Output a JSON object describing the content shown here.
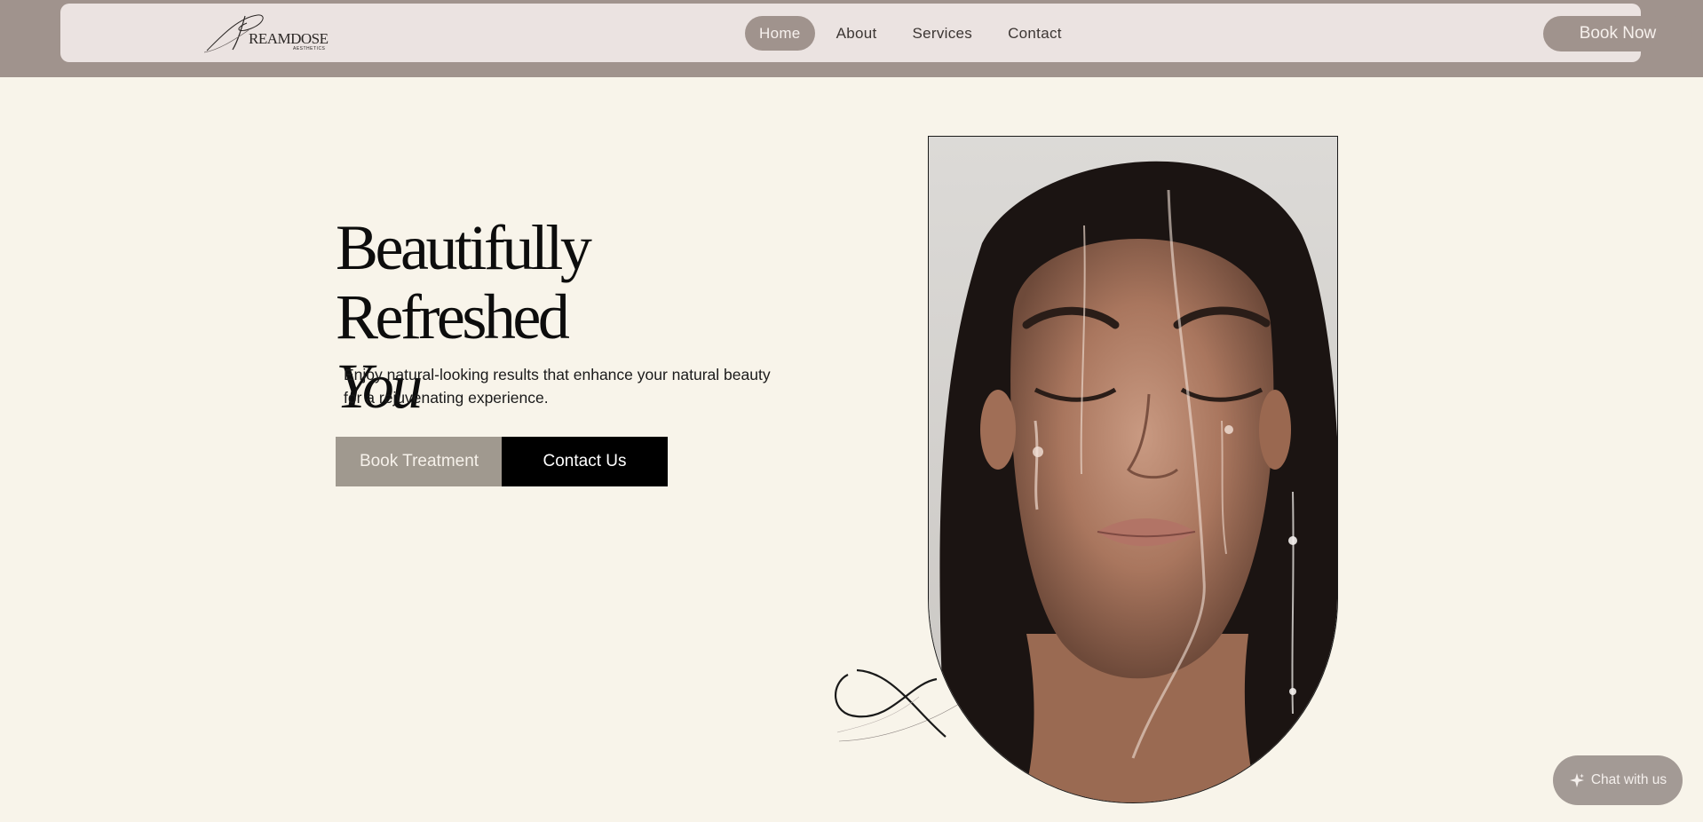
{
  "brand": {
    "logo_text": "REAMDOSE",
    "logo_sub": "AESTHETICS"
  },
  "nav": {
    "items": [
      {
        "label": "Home",
        "active": true
      },
      {
        "label": "About",
        "active": false
      },
      {
        "label": "Services",
        "active": false
      },
      {
        "label": "Contact",
        "active": false
      }
    ],
    "book_now_label": "Book Now"
  },
  "hero": {
    "title_line1": "Beautifully Refreshed",
    "title_line2": "You",
    "subtitle": "Enjoy natural-looking results that enhance your natural beauty for a rejuvenating experience.",
    "primary_button": "Book Treatment",
    "secondary_button": "Contact Us"
  },
  "chat": {
    "label": "Chat with us",
    "icon": "sparkle-icon"
  },
  "colors": {
    "background": "#f8f4ea",
    "header_band": "#a0938d",
    "nav_bar": "#ebe3e1",
    "accent": "#a0938d",
    "book_treatment_button": "#a0998f",
    "contact_button": "#000000"
  }
}
